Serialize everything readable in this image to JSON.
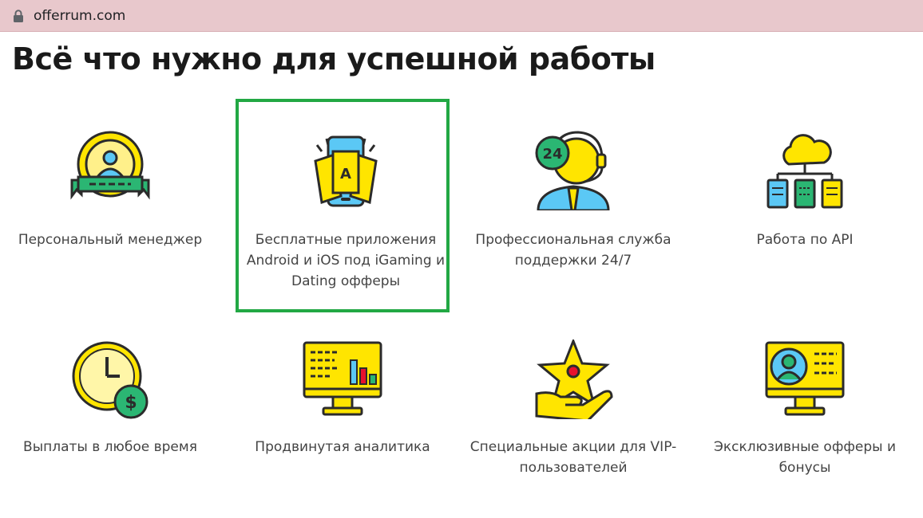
{
  "browser": {
    "url": "offerrum.com"
  },
  "page": {
    "title": "Всё что нужно для успешной работы"
  },
  "features": [
    {
      "label": "Персональный менеджер",
      "icon": "manager-badge-icon"
    },
    {
      "label": "Бесплатные приложения Android и iOS под iGaming и Dating офферы",
      "icon": "phone-cards-icon",
      "highlighted": true
    },
    {
      "label": "Профессиональная служба поддержки 24/7",
      "icon": "support-24-icon"
    },
    {
      "label": "Работа по API",
      "icon": "cloud-api-icon"
    },
    {
      "label": "Выплаты в любое время",
      "icon": "clock-dollar-icon"
    },
    {
      "label": "Продвинутая аналитика",
      "icon": "analytics-monitor-icon"
    },
    {
      "label": "Специальные акции для VIP-пользователей",
      "icon": "star-hand-icon"
    },
    {
      "label": "Эксклюзивные офферы и бонусы",
      "icon": "exclusive-monitor-icon"
    }
  ],
  "colors": {
    "yellow": "#ffe500",
    "outline": "#2b2b2b",
    "green": "#2bb673",
    "blue": "#5bc8f5",
    "highlight": "#22a844",
    "red": "#e8112d"
  }
}
